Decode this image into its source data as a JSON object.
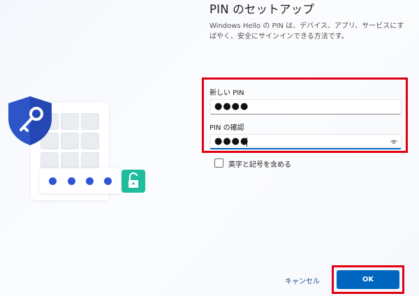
{
  "header": {
    "title": "PIN のセットアップ",
    "description": "Windows Hello の PIN は、デバイス、アプリ、サービスにすばやく、安全にサインインできる方法です。"
  },
  "form": {
    "new_pin_label": "新しい PIN",
    "new_pin_value": "●●●●",
    "confirm_pin_label": "PIN の確認",
    "confirm_pin_value": "●●●●",
    "include_letters_label": "英字と記号を含める",
    "include_letters_checked": false
  },
  "buttons": {
    "cancel_label": "キャンセル",
    "ok_label": "OK"
  },
  "colors": {
    "accent": "#0067c0",
    "highlight": "#e00012",
    "shield": "#2d55c8",
    "lock_badge": "#1dbd9e",
    "pin_dot": "#2f55d4"
  },
  "icons": {
    "shield": "shield-key-icon",
    "lock": "unlocked-padlock-icon",
    "reveal": "eye-icon"
  }
}
